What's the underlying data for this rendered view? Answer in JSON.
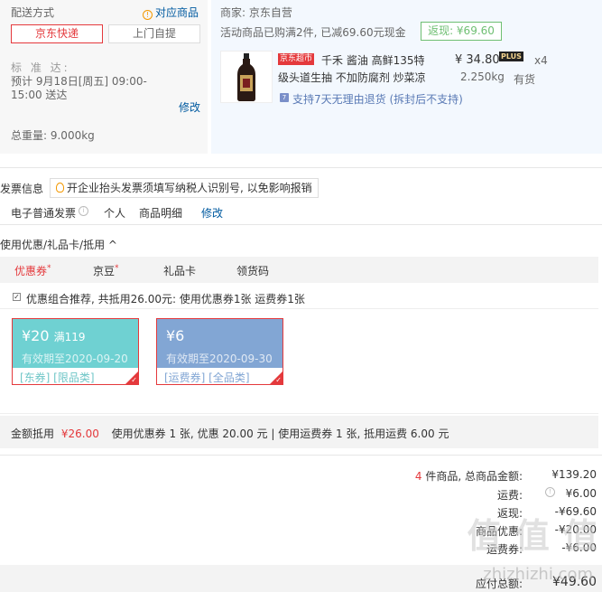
{
  "shipping": {
    "title": "配送方式",
    "link": "对应商品",
    "option_selected": "京东快递",
    "option_other": "上门自提",
    "standard_label": "标 准 达:",
    "eta_line1": "预计 9月18日[周五] 09:00-",
    "eta_line2": "15:00 送达",
    "edit": "修改",
    "total_weight": "总重量: 9.000kg"
  },
  "seller": {
    "name": "商家: 京东自营",
    "promo": "活动商品已购满2件, 已减69.60元现金",
    "rebate": "返现: ¥69.60"
  },
  "product": {
    "tag": "京东超市",
    "title_line1": "千禾 酱油 高鲜135特",
    "title_line2": "级头道生抽 不加防腐剂 炒菜凉",
    "price": "¥ 34.80",
    "plus_badge": "PLUS",
    "quantity": "x4",
    "weight": "2.250kg",
    "stock": "有货",
    "return_policy": "支持7天无理由退货 (拆封后不支持)"
  },
  "invoice": {
    "label": "发票信息",
    "note": "开企业抬头发票须填写纳税人识别号, 以免影响报销",
    "type": "电子普通发票",
    "person": "个人",
    "detail": "商品明细",
    "edit": "修改"
  },
  "coupons": {
    "title": "使用优惠/礼品卡/抵用 ^",
    "tabs": [
      "优惠券",
      "京豆",
      "礼品卡",
      "领货码"
    ],
    "combo_text": "优惠组合推荐, 共抵用26.00元: 使用优惠券1张 运费券1张",
    "items": [
      {
        "amount": "¥20",
        "condition": "满119",
        "expiry": "有效期至2020-09-20",
        "tags": "[东券]  [限品类]"
      },
      {
        "amount": "¥6",
        "condition": "",
        "expiry": "有效期至2020-09-30",
        "tags": "[运费券]  [全品类]"
      }
    ],
    "summary_label": "金额抵用",
    "summary_amount": "¥26.00",
    "summary_detail": "使用优惠券 1 张, 优惠 20.00 元  | 使用运费券 1 张, 抵用运费 6.00 元"
  },
  "totals": {
    "count_prefix": "4",
    "count_suffix": " 件商品, 总商品金额:",
    "goods_value": "¥139.20",
    "shipping_label": "运费:",
    "shipping_value": "¥6.00",
    "rebate_label": "返现:",
    "rebate_value": "-¥69.60",
    "coupon_label": "商品优惠:",
    "coupon_value": "-¥20.00",
    "ship_coupon_label": "运费券:",
    "ship_coupon_value": "-¥6.00",
    "payable_label": "应付总额:",
    "payable_value": "¥49.60"
  },
  "watermark": {
    "text": "值 值 值",
    "url": "zhizhizhi.com"
  },
  "colors": {
    "accent_red": "#e4393c",
    "link_blue": "#005aa0",
    "coupon_teal": "#6fd1d2",
    "coupon_blue": "#82a6d4",
    "rebate_green": "#6fbf73"
  }
}
